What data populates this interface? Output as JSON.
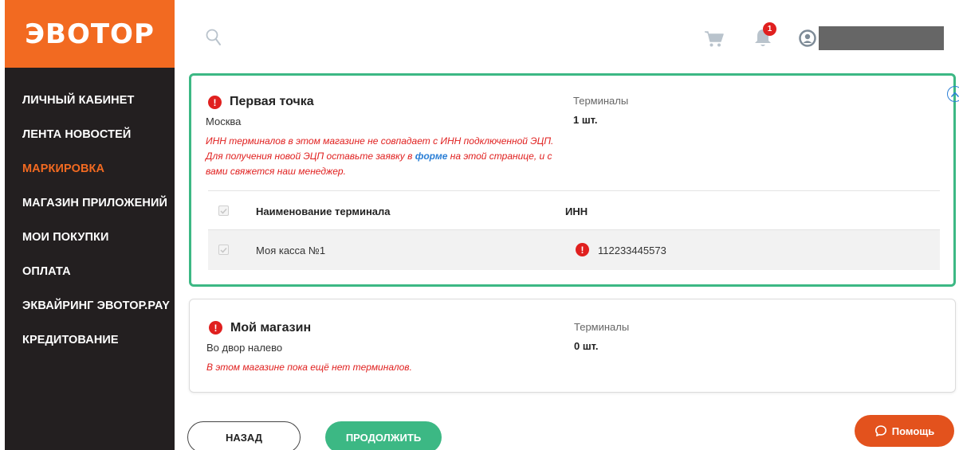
{
  "sidebar": {
    "logo": "ЭВОТОР",
    "items": [
      {
        "label": "ЛИЧНЫЙ КАБИНЕТ"
      },
      {
        "label": "ЛЕНТА НОВОСТЕЙ"
      },
      {
        "label": "МАРКИРОВКА",
        "active": true
      },
      {
        "label": "МАГАЗИН ПРИЛОЖЕНИЙ"
      },
      {
        "label": "МОИ ПОКУПКИ"
      },
      {
        "label": "ОПЛАТА"
      },
      {
        "label": "ЭКВАЙРИНГ ЭВОТОР.PAY"
      },
      {
        "label": "КРЕДИТОВАНИЕ"
      }
    ]
  },
  "header": {
    "notifications_count": "1"
  },
  "stores": [
    {
      "alert_icon": "!",
      "title": "Первая точка",
      "address": "Москва",
      "warning_part1": "ИНН терминалов в этом магазине не совпадает с ИНН подключенной ЭЦП. Для получения новой ЭЦП оставьте заявку в ",
      "warning_link": "форме",
      "warning_part2": " на этой странице, и с вами свяжется наш менеджер.",
      "terminals_label": "Терминалы",
      "terminals_value": "1 шт.",
      "table": {
        "col_name": "Наименование терминала",
        "col_inn": "ИНН",
        "rows": [
          {
            "name": "Моя касса №1",
            "inn": "112233445573",
            "alert_icon": "!"
          }
        ]
      }
    },
    {
      "alert_icon": "!",
      "title": "Мой магазин",
      "address": "Во двор налево",
      "warning": "В этом магазине пока ещё нет терминалов.",
      "terminals_label": "Терминалы",
      "terminals_value": "0 шт."
    }
  ],
  "buttons": {
    "back": "НАЗАД",
    "next": "ПРОДОЛЖИТЬ",
    "help": "Помощь"
  },
  "colors": {
    "brand_orange": "#f26a21",
    "sidebar_bg": "#231f20",
    "accent_green": "#3cb884",
    "error_red": "#e0201f",
    "link_blue": "#2b7fd6",
    "help_orange": "#e3521d"
  }
}
